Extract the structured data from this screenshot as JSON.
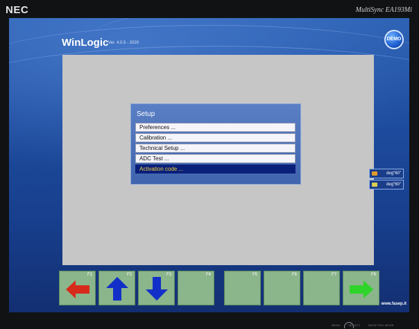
{
  "monitor": {
    "brand": "NEC",
    "model": "MultiSync EA193Mi",
    "osd_labels": [
      "MENU",
      "SELECT",
      "RESET/DV MODE"
    ]
  },
  "app": {
    "title": "WinLogic",
    "version": "Ver. 4.0.5 - 2020",
    "demo_badge": "DEMO",
    "website": "www.fasep.it"
  },
  "dialog": {
    "title": "Setup",
    "items": [
      {
        "label": "Preferences ...",
        "selected": false
      },
      {
        "label": "Calibration ...",
        "selected": false
      },
      {
        "label": "Technical Setup ...",
        "selected": false
      },
      {
        "label": "ADC Test ...",
        "selected": false
      },
      {
        "label": "Activation code ...",
        "selected": true
      }
    ]
  },
  "side_panel": [
    {
      "label": "deg\"60\""
    },
    {
      "label": "deg\"60\""
    }
  ],
  "function_keys": [
    {
      "label": "F1",
      "icon": "arrow-left-red-icon"
    },
    {
      "label": "F2",
      "icon": "arrow-up-blue-icon"
    },
    {
      "label": "F3",
      "icon": "arrow-down-blue-icon"
    },
    {
      "label": "F4",
      "icon": ""
    },
    {
      "label": "F5",
      "icon": ""
    },
    {
      "label": "F6",
      "icon": ""
    },
    {
      "label": "F7",
      "icon": ""
    },
    {
      "label": "F8",
      "icon": "arrow-right-green-icon"
    }
  ],
  "colors": {
    "screen_bg": "#1e4c9e",
    "panel_bg": "#c6c6c6",
    "selected_item_bg": "#0a1f7a",
    "selected_item_text": "#f0d23a",
    "fkey_bg": "#8bb58b"
  }
}
